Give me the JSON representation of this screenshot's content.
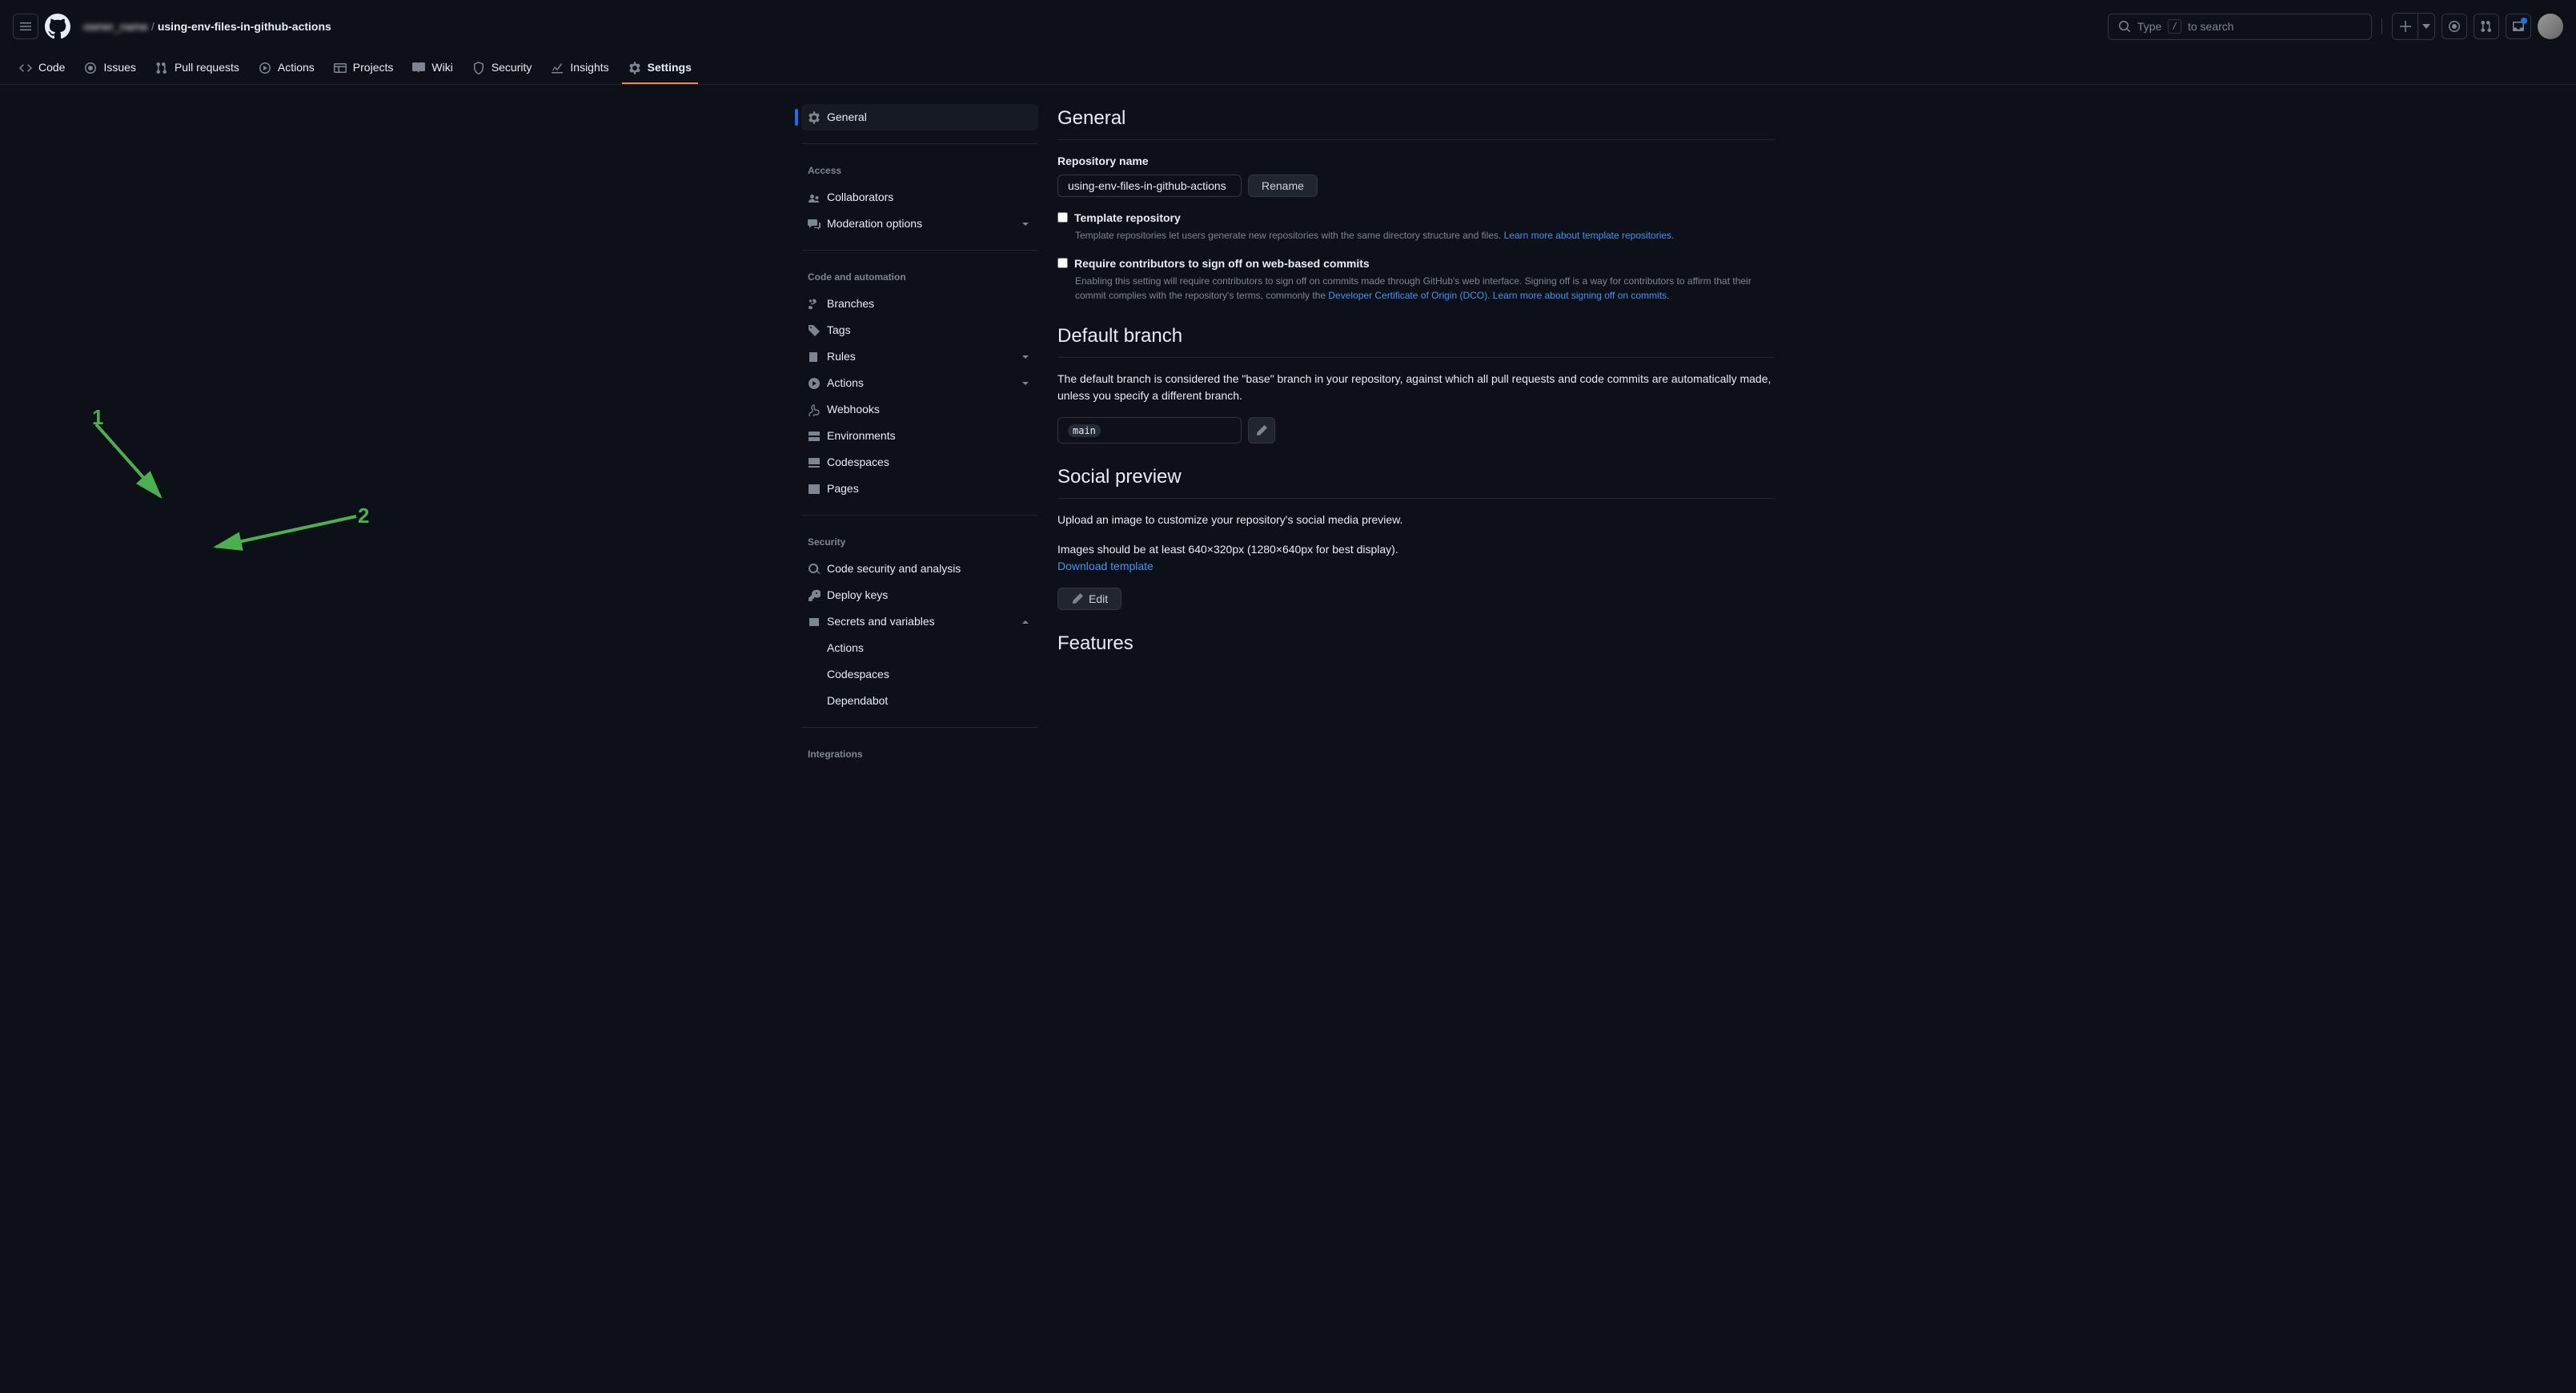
{
  "header": {
    "owner": "owner_name",
    "repo": "using-env-files-in-github-actions",
    "search_prefix": "Type",
    "search_key": "/",
    "search_suffix": "to search"
  },
  "repo_nav": {
    "code": "Code",
    "issues": "Issues",
    "pulls": "Pull requests",
    "actions": "Actions",
    "projects": "Projects",
    "wiki": "Wiki",
    "security": "Security",
    "insights": "Insights",
    "settings": "Settings"
  },
  "sidebar": {
    "general": "General",
    "access_heading": "Access",
    "collaborators": "Collaborators",
    "moderation": "Moderation options",
    "code_auto_heading": "Code and automation",
    "branches": "Branches",
    "tags": "Tags",
    "rules": "Rules",
    "actions": "Actions",
    "webhooks": "Webhooks",
    "environments": "Environments",
    "codespaces": "Codespaces",
    "pages": "Pages",
    "security_heading": "Security",
    "code_security": "Code security and analysis",
    "deploy_keys": "Deploy keys",
    "secrets_vars": "Secrets and variables",
    "sub_actions": "Actions",
    "sub_codespaces": "Codespaces",
    "sub_dependabot": "Dependabot",
    "integrations_heading": "Integrations"
  },
  "content": {
    "general_heading": "General",
    "repo_name_label": "Repository name",
    "repo_name_value": "using-env-files-in-github-actions",
    "rename_btn": "Rename",
    "template_label": "Template repository",
    "template_desc": "Template repositories let users generate new repositories with the same directory structure and files. ",
    "template_link": "Learn more about template repositories.",
    "signoff_label": "Require contributors to sign off on web-based commits",
    "signoff_desc1": "Enabling this setting will require contributors to sign off on commits made through GitHub's web interface. Signing off is a way for contributors to affirm that their commit complies with the repository's terms, commonly the ",
    "signoff_link1": "Developer Certificate of Origin (DCO)",
    "signoff_desc2": ". ",
    "signoff_link2": "Learn more about signing off on commits.",
    "default_branch_heading": "Default branch",
    "default_branch_desc": "The default branch is considered the \"base\" branch in your repository, against which all pull requests and code commits are automatically made, unless you specify a different branch.",
    "default_branch_value": "main",
    "social_heading": "Social preview",
    "social_desc1": "Upload an image to customize your repository's social media preview.",
    "social_desc2": "Images should be at least 640×320px (1280×640px for best display).",
    "download_tmpl": "Download template",
    "edit_btn": "Edit",
    "features_heading": "Features"
  },
  "annotations": {
    "one": "1",
    "two": "2"
  }
}
